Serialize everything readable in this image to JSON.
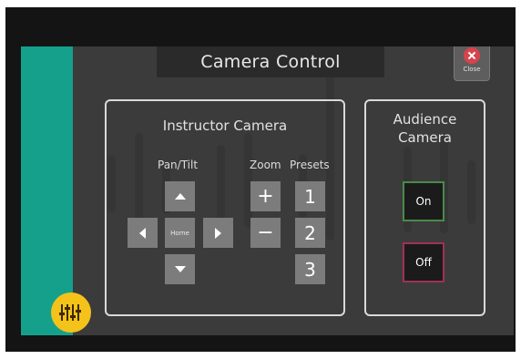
{
  "header": {
    "title": "Camera Control",
    "close_label": "Close"
  },
  "instructor": {
    "title": "Instructor Camera",
    "pan_tilt_label": "Pan/Tilt",
    "zoom_label": "Zoom",
    "presets_label": "Presets",
    "home_label": "Home",
    "zoom_in_symbol": "+",
    "zoom_out_symbol": "−",
    "presets": [
      "1",
      "2",
      "3"
    ]
  },
  "audience": {
    "title": "Audience Camera",
    "on_label": "On",
    "off_label": "Off"
  },
  "colors": {
    "accent_teal": "#15a08c",
    "on_border": "#4a8a4a",
    "off_border": "#a0305a",
    "close_red": "#d8434b",
    "fab_yellow": "#f5c21a"
  },
  "icons": {
    "close": "close-icon",
    "arrows": [
      "arrow-up-icon",
      "arrow-down-icon",
      "arrow-left-icon",
      "arrow-right-icon"
    ],
    "fab": "sliders-icon"
  }
}
